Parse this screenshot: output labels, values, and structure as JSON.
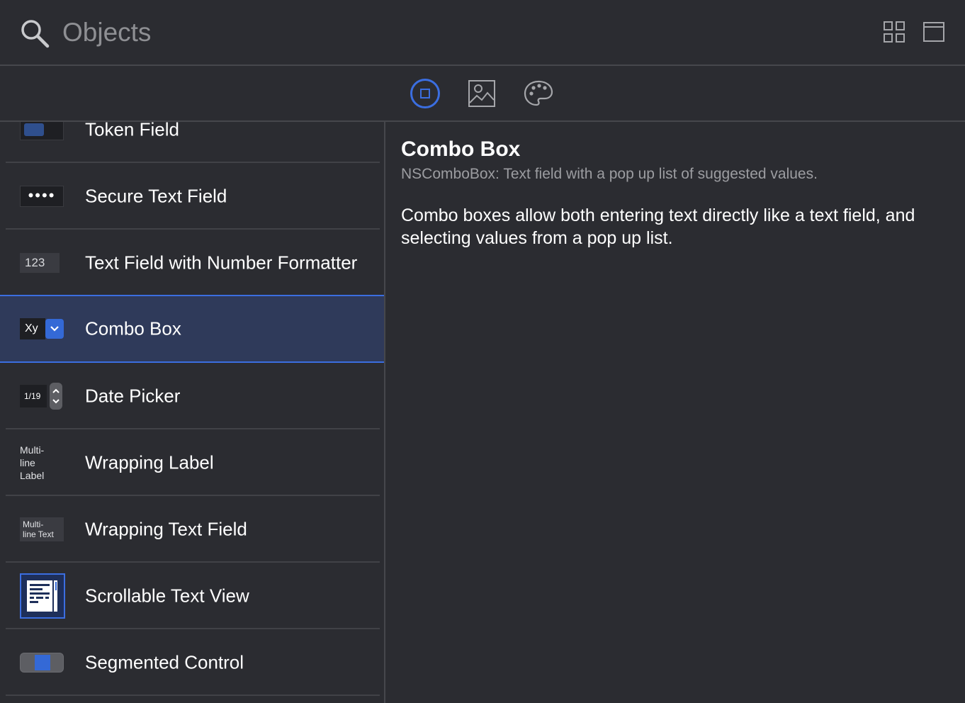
{
  "search": {
    "placeholder": "Objects"
  },
  "toolbar": {
    "grid_view_icon": "grid-view-icon",
    "list_view_icon": "detail-view-icon"
  },
  "tabs": [
    {
      "name": "objects",
      "icon": "square-in-circle-icon",
      "selected": true
    },
    {
      "name": "media",
      "icon": "image-icon",
      "selected": false
    },
    {
      "name": "colors",
      "icon": "palette-icon",
      "selected": false
    }
  ],
  "accent_color": "#3b6ee0",
  "list": {
    "items": [
      {
        "label": "Token Field"
      },
      {
        "label": "Secure Text Field",
        "thumb_text": "••••"
      },
      {
        "label": "Text Field with Number Formatter",
        "thumb_text": "123"
      },
      {
        "label": "Combo Box",
        "thumb_text": "Xy",
        "selected": true
      },
      {
        "label": "Date Picker",
        "thumb_text": "1/19"
      },
      {
        "label": "Wrapping Label",
        "thumb_lines": [
          "Multi-",
          "line",
          "Label"
        ]
      },
      {
        "label": "Wrapping Text Field",
        "thumb_lines": [
          "Multi-",
          "line Text"
        ]
      },
      {
        "label": "Scrollable Text View"
      },
      {
        "label": "Segmented Control"
      }
    ]
  },
  "detail": {
    "title": "Combo Box",
    "subtitle": "NSComboBox: Text field with a pop up list of suggested values.",
    "description": "Combo boxes allow both entering text directly like a text field, and selecting values from a pop up list."
  }
}
